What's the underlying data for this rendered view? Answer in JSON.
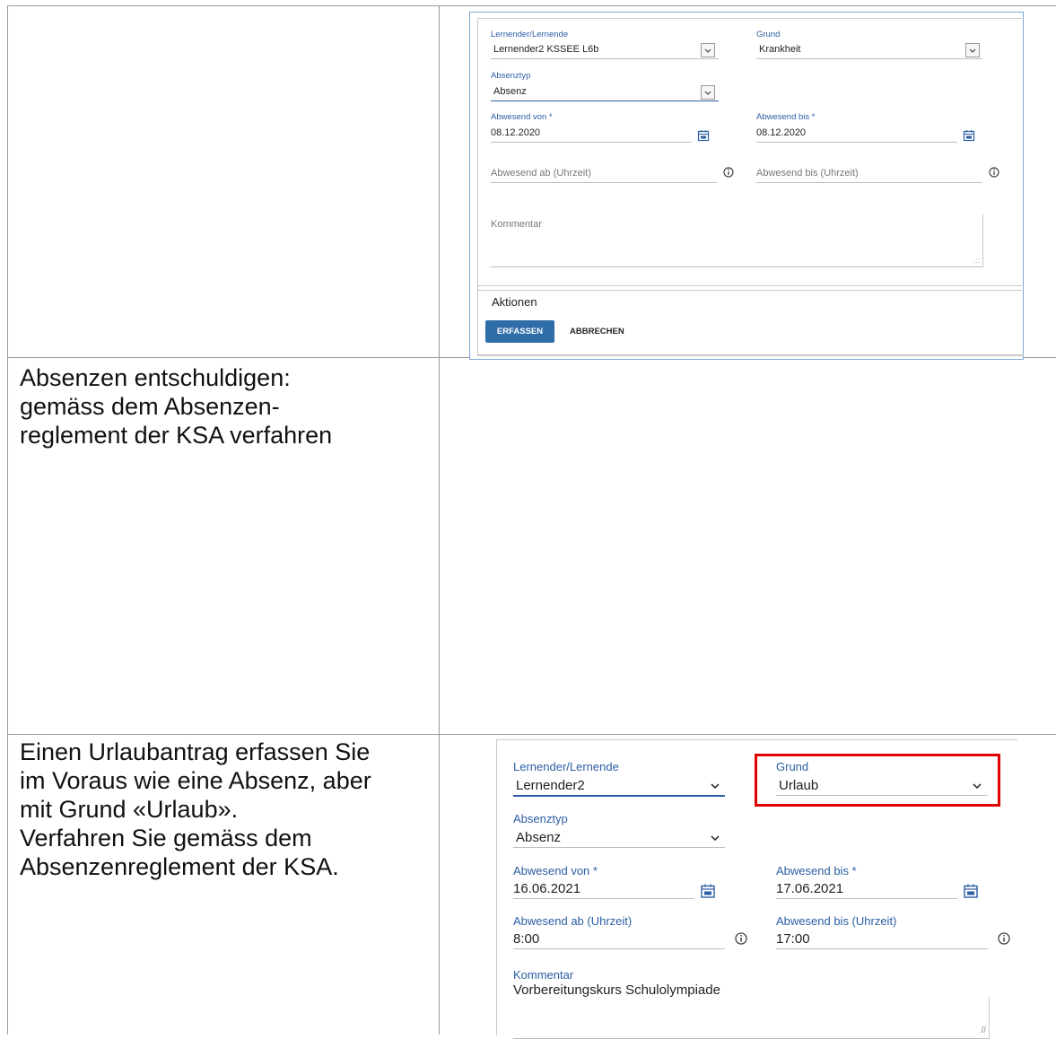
{
  "row1": {
    "form": {
      "learner_label": "Lernender/Lernende",
      "learner_value": "Lernender2 KSSEE L6b",
      "reason_label": "Grund",
      "reason_value": "Krankheit",
      "type_label": "Absenztyp",
      "type_value": "Absenz",
      "from_label": "Abwesend von *",
      "from_value": "08.12.2020",
      "to_label": "Abwesend bis *",
      "to_value": "08.12.2020",
      "from_time_placeholder": "Abwesend ab (Uhrzeit)",
      "to_time_placeholder": "Abwesend bis (Uhrzeit)",
      "comment_placeholder": "Kommentar"
    },
    "actions": {
      "title": "Aktionen",
      "submit_label": "ERFASSEN",
      "cancel_label": "ABBRECHEN"
    }
  },
  "row2": {
    "text_lines": [
      "Absenzen entschuldigen:",
      "gemäss dem Absenzen-",
      "reglement der KSA verfahren"
    ]
  },
  "row3": {
    "text_lines": [
      "Einen Urlaubantrag erfassen Sie",
      "im Voraus wie eine Absenz, aber",
      "mit Grund «Urlaub».",
      "Verfahren Sie  gemäss dem",
      "Absenzenreglement der KSA."
    ],
    "form": {
      "learner_label": "Lernender/Lernende",
      "learner_value": "Lernender2",
      "reason_label": "Grund",
      "reason_value": "Urlaub",
      "type_label": "Absenztyp",
      "type_value": "Absenz",
      "from_label": "Abwesend von *",
      "from_value": "16.06.2021",
      "to_label": "Abwesend bis *",
      "to_value": "17.06.2021",
      "from_time_label": "Abwesend ab (Uhrzeit)",
      "from_time_value": "8:00",
      "to_time_label": "Abwesend bis (Uhrzeit)",
      "to_time_value": "17:00",
      "comment_label": "Kommentar",
      "comment_value": "Vorbereitungskurs Schulolympiade"
    }
  },
  "colors": {
    "accent": "#2b5ea4",
    "primary_button": "#2f6da8",
    "highlight": "#e00000"
  },
  "icons": [
    "chevron-down-icon",
    "calendar-icon",
    "info-icon"
  ]
}
